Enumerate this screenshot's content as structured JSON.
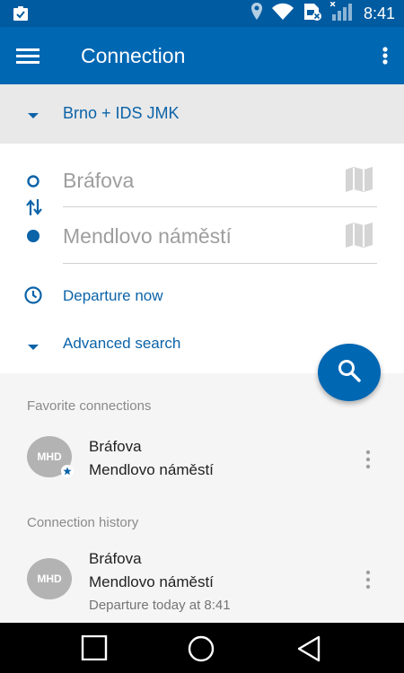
{
  "status_bar": {
    "time": "8:41",
    "icons": [
      "clipboard-check-icon",
      "location-icon",
      "wifi-icon",
      "sim-no-signal-icon",
      "signal-bars-icon"
    ]
  },
  "app_bar": {
    "title": "Connection",
    "left_icon": "hamburger-menu-icon",
    "right_icon": "more-vertical-icon"
  },
  "region": {
    "label": "Brno + IDS JMK",
    "icon": "caret-down-icon"
  },
  "search_form": {
    "from": "Bráfova",
    "to": "Mendlovo náměstí",
    "departure_label": "Departure now",
    "advanced_label": "Advanced search"
  },
  "colors": {
    "primary": "#0067b3",
    "status_bar": "#005ba0",
    "accent_text": "#0b63a8",
    "region_bar_bg": "#e9e9e9",
    "list_bg": "#f5f5f5"
  },
  "favorites": {
    "header": "Favorite connections",
    "items": [
      {
        "avatar": "MHD",
        "from": "Bráfova",
        "to": "Mendlovo náměstí"
      }
    ]
  },
  "history": {
    "header": "Connection history",
    "items": [
      {
        "avatar": "MHD",
        "from": "Bráfova",
        "to": "Mendlovo náměstí",
        "detail": "Departure today at 8:41"
      }
    ]
  }
}
